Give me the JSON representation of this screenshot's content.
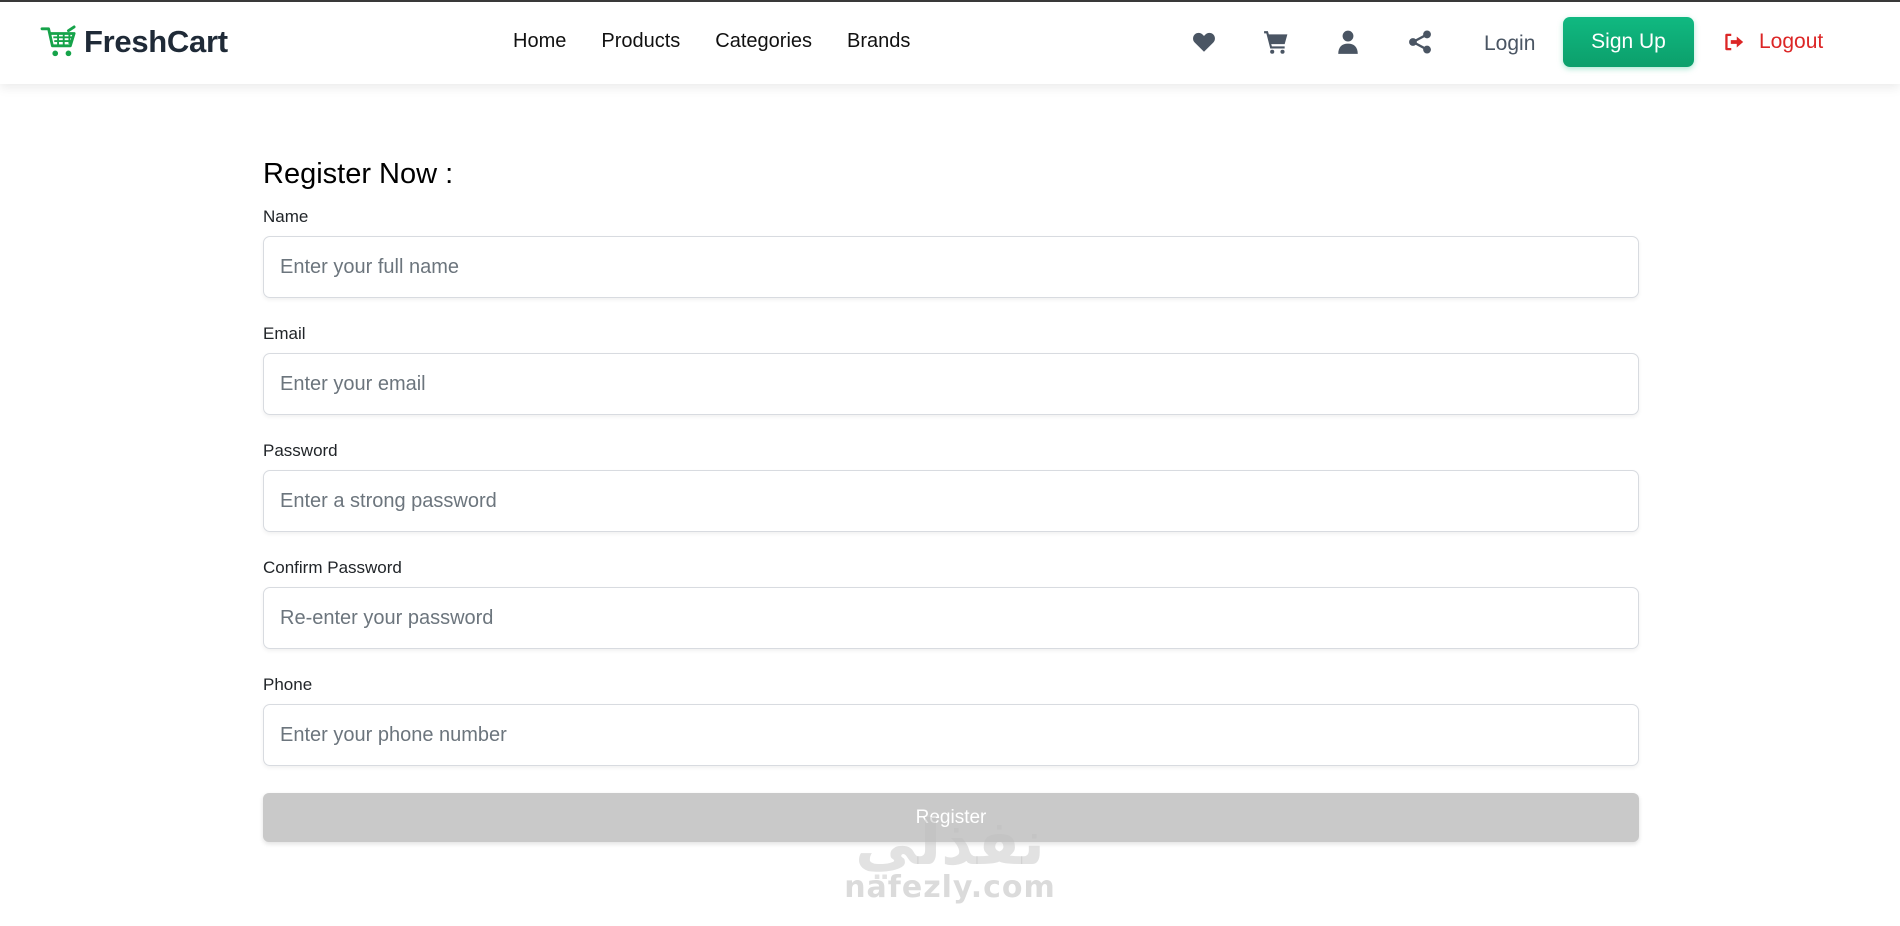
{
  "brand": {
    "name": "FreshCart",
    "logo_icon": "cart-icon",
    "accent_color": "#10b981"
  },
  "nav": {
    "links": [
      {
        "label": "Home"
      },
      {
        "label": "Products"
      },
      {
        "label": "Categories"
      },
      {
        "label": "Brands"
      }
    ],
    "icons": [
      "heart-icon",
      "cart-icon",
      "user-icon",
      "share-icon"
    ],
    "login_label": "Login",
    "signup_label": "Sign Up",
    "logout_label": "Logout",
    "logout_color": "#dc2626"
  },
  "form": {
    "title": "Register Now :",
    "fields": [
      {
        "label": "Name",
        "placeholder": "Enter your full name",
        "value": ""
      },
      {
        "label": "Email",
        "placeholder": "Enter your email",
        "value": ""
      },
      {
        "label": "Password",
        "placeholder": "Enter a strong password",
        "value": ""
      },
      {
        "label": "Confirm Password",
        "placeholder": "Re-enter your password",
        "value": ""
      },
      {
        "label": "Phone",
        "placeholder": "Enter your phone number",
        "value": ""
      }
    ],
    "submit_label": "Register",
    "submit_disabled": true
  },
  "watermark": {
    "arabic": "نفذلي",
    "site": "nafezly.com"
  }
}
